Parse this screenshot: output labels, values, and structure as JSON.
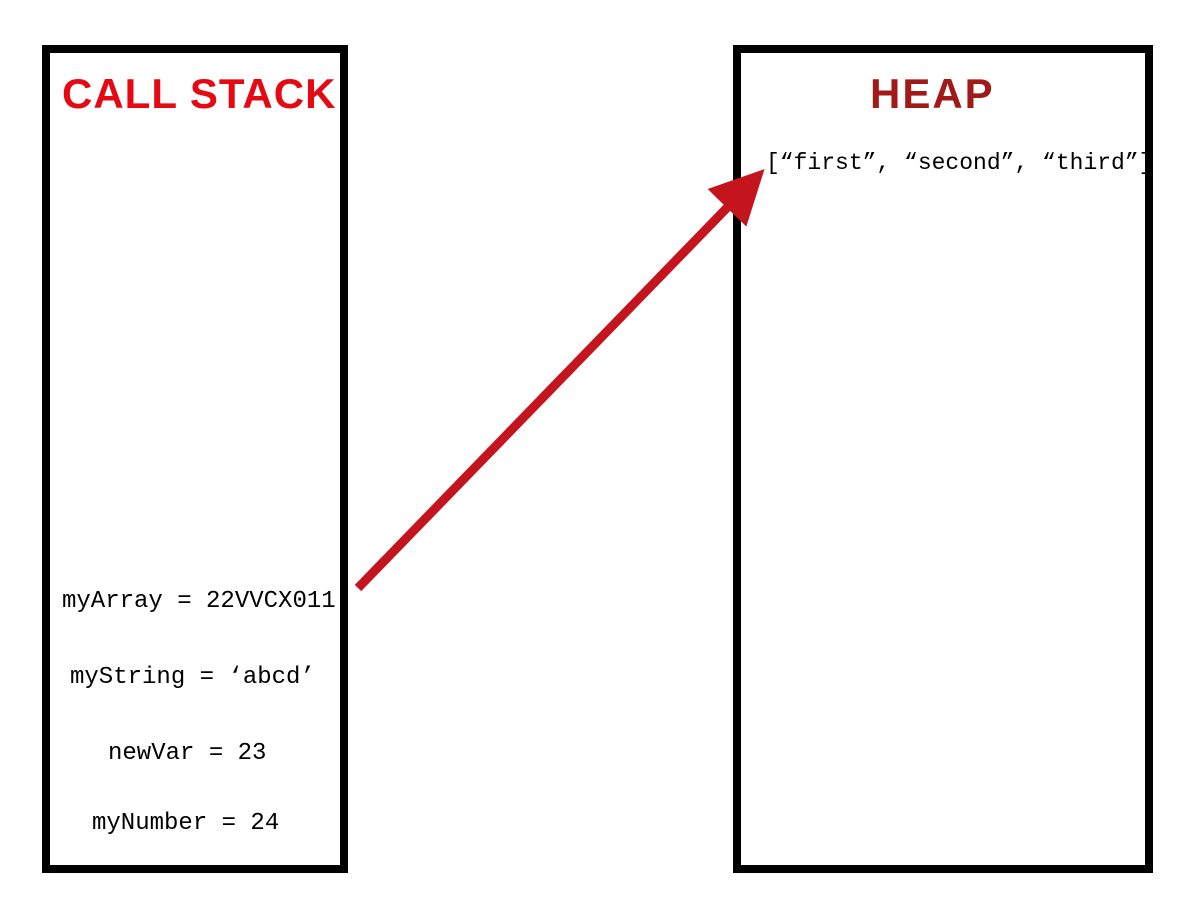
{
  "callStack": {
    "title": "CALL STACK",
    "lines": [
      "myArray = 22VVCX011",
      "myString = ‘abcd’",
      "newVar = 23",
      "myNumber = 24"
    ]
  },
  "heap": {
    "title": "HEAP",
    "content": "[“first”, “second”, “third”]"
  },
  "colors": {
    "arrowColor": "#c4141d"
  }
}
